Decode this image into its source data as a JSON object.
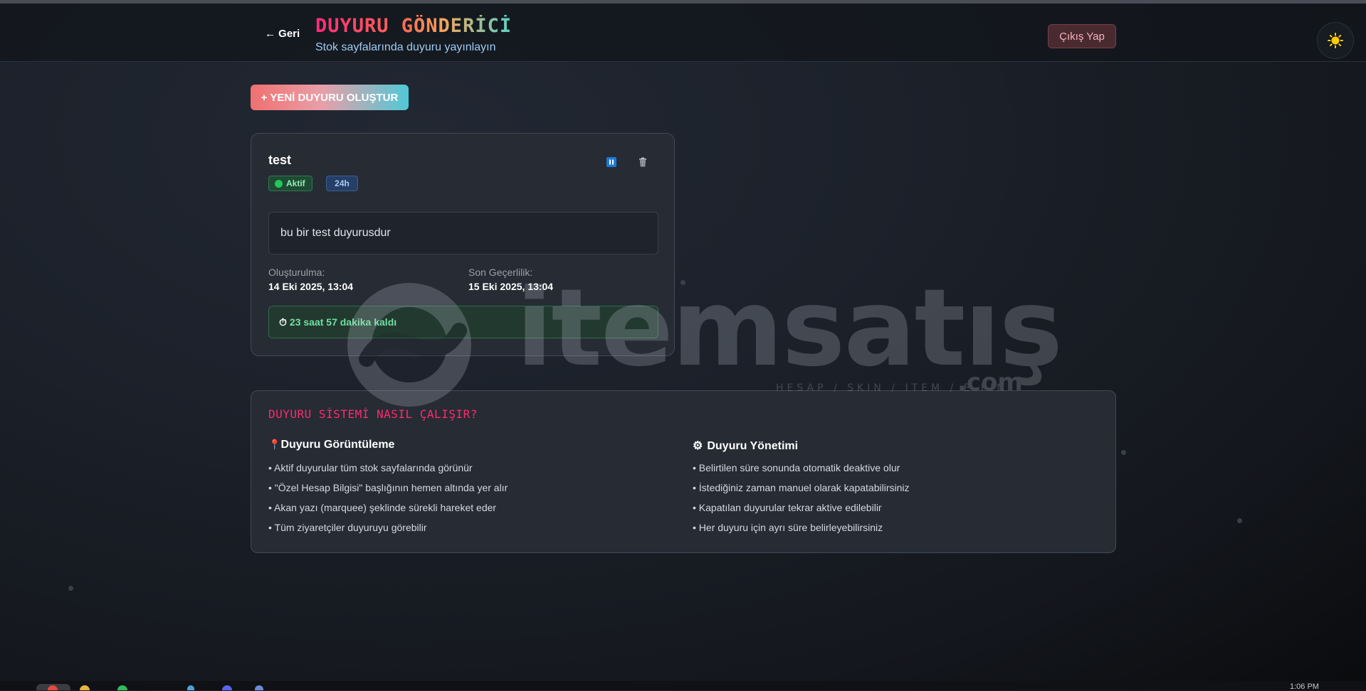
{
  "header": {
    "back_label": "← Geri",
    "title": "DUYURU GÖNDERİCİ",
    "subtitle": "Stok sayfalarında duyuru yayınlayın",
    "logout_label": "Çıkış Yap",
    "theme_icon": "sun-icon"
  },
  "actions": {
    "new_announcement_label": "+ YENİ DUYURU OLUŞTUR"
  },
  "announcement": {
    "title": "test",
    "status_label": "Aktif",
    "duration_label": "24h",
    "message": "bu bir test duyurusdur",
    "created_label": "Oluşturulma:",
    "created_value": "14 Eki 2025, 13:04",
    "expires_label": "Son Geçerlilik:",
    "expires_value": "15 Eki 2025, 13:04",
    "timer_icon": "⏱",
    "remaining_label": "23 saat 57 dakika kaldı",
    "pause_icon": "pause-icon",
    "delete_icon": "trash-icon"
  },
  "info": {
    "title": "DUYURU SİSTEMİ NASIL ÇALIŞIR?",
    "display": {
      "icon": "📍",
      "heading": "Duyuru Görüntüleme",
      "items": [
        "• Aktif duyurular tüm stok sayfalarında görünür",
        "• \"Özel Hesap Bilgisi\" başlığının hemen altında yer alır",
        "• Akan yazı (marquee) şeklinde sürekli hareket eder",
        "• Tüm ziyaretçiler duyuruyu görebilir"
      ]
    },
    "management": {
      "icon": "⚙",
      "heading": "Duyuru Yönetimi",
      "items": [
        "• Belirtilen süre sonunda otomatik deaktive olur",
        "• İstediğiniz zaman manuel olarak kapatabilirsiniz",
        "• Kapatılan duyurular tekrar aktive edilebilir",
        "• Her duyuru için ayrı süre belirleyebilirsiniz"
      ]
    }
  },
  "watermark": {
    "brand": "itemsatış",
    "tagline": "HESAP / SKIN / ITEM / E-PIN",
    "suffix": ".com"
  },
  "taskbar": {
    "clock": "1:06 PM"
  },
  "colors": {
    "accent_pink": "#ff2a6e",
    "success_green": "#22c85a",
    "info_blue": "#1e7ad4",
    "background": "#1b2029"
  }
}
